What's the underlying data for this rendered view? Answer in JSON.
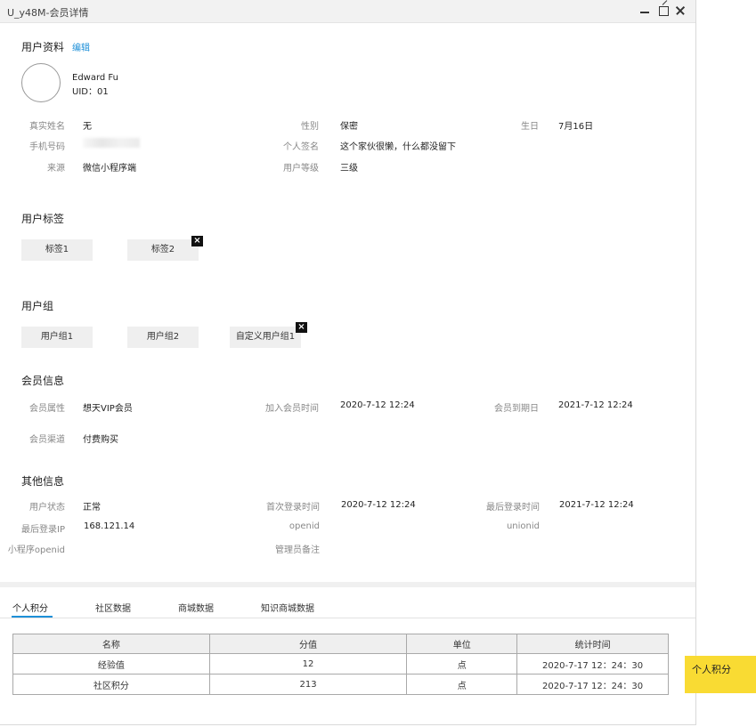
{
  "window": {
    "title": "U_y48M-会员详情"
  },
  "profile": {
    "section_title": "用户资料",
    "edit_label": "编辑",
    "name": "Edward Fu",
    "uid": "UID：01",
    "fields": [
      {
        "label": "真实姓名",
        "value": "无"
      },
      {
        "label": "性别",
        "value": "保密"
      },
      {
        "label": "生日",
        "value": "7月16日"
      },
      {
        "label": "手机号码",
        "value": ""
      },
      {
        "label": "个人签名",
        "value": "这个家伙很懒，什么都没留下"
      },
      {
        "label": "来源",
        "value": "微信小程序端"
      },
      {
        "label": "用户等级",
        "value": "三级"
      }
    ]
  },
  "tags": {
    "section_title": "用户标签",
    "items": [
      "标签1",
      "标签2"
    ]
  },
  "groups": {
    "section_title": "用户组",
    "items": [
      "用户组1",
      "用户组2",
      "自定义用户组1"
    ]
  },
  "membership": {
    "section_title": "会员信息",
    "fields": [
      {
        "label": "会员属性",
        "value": "想天VIP会员"
      },
      {
        "label": "加入会员时间",
        "value": "2020-7-12 12:24"
      },
      {
        "label": "会员到期日",
        "value": "2021-7-12 12:24"
      },
      {
        "label": "会员渠道",
        "value": "付费购买"
      }
    ]
  },
  "other": {
    "section_title": "其他信息",
    "fields": [
      {
        "label": "用户状态",
        "value": "正常"
      },
      {
        "label": "首次登录时间",
        "value": "2020-7-12 12:24"
      },
      {
        "label": "最后登录时间",
        "value": "2021-7-12 12:24"
      },
      {
        "label": "最后登录IP",
        "value": "168.121.14"
      },
      {
        "label": "openid",
        "value": ""
      },
      {
        "label": "unionid",
        "value": ""
      },
      {
        "label": "小程序openid",
        "value": ""
      },
      {
        "label": "管理员备注",
        "value": ""
      }
    ]
  },
  "tabs": [
    "个人积分",
    "社区数据",
    "商城数据",
    "知识商城数据"
  ],
  "points_table": {
    "headers": [
      "名称",
      "分值",
      "单位",
      "统计时间"
    ],
    "rows": [
      [
        "经验值",
        "12",
        "点",
        "2020-7-17 12：24：30"
      ],
      [
        "社区积分",
        "213",
        "点",
        "2020-7-17 12：24：30"
      ]
    ]
  },
  "side_note": "个人积分"
}
